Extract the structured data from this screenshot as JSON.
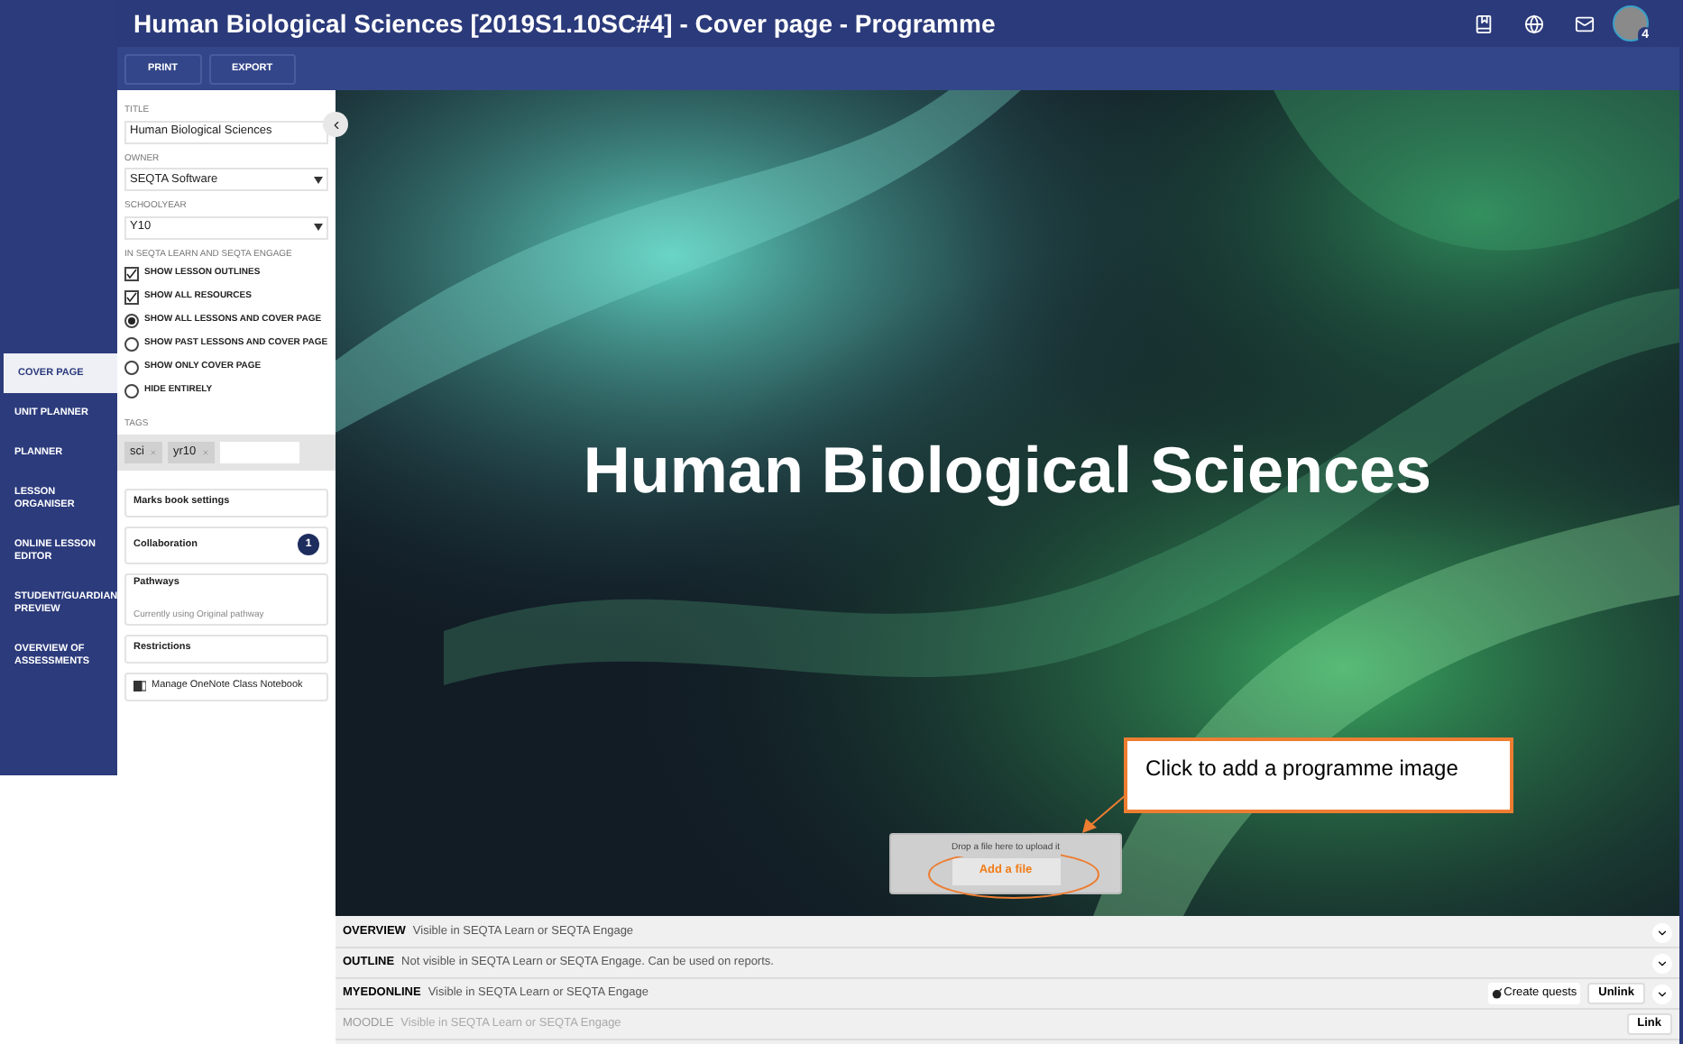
{
  "header": {
    "title": "Human Biological Sciences [2019S1.10SC#4] - Cover page - Programme",
    "notification_count": "4"
  },
  "toolbar": [
    "PRINT",
    "EXPORT"
  ],
  "nav": [
    {
      "label": "COVER PAGE",
      "selected": true
    },
    {
      "label": "UNIT PLANNER",
      "selected": false
    },
    {
      "label": "PLANNER",
      "selected": false
    },
    {
      "label": "LESSON ORGANISER",
      "selected": false
    },
    {
      "label": "ONLINE LESSON EDITOR",
      "selected": false
    },
    {
      "label": "STUDENT/GUARDIAN PREVIEW",
      "selected": false
    },
    {
      "label": "OVERVIEW OF ASSESSMENTS",
      "selected": false
    }
  ],
  "form": {
    "title_label": "TITLE",
    "title_value": "Human Biological Sciences",
    "owner_label": "OWNER",
    "owner_value": "SEQTA Software",
    "year_label": "SCHOOLYEAR",
    "year_value": "Y10",
    "visibility_label": "IN SEQTA LEARN AND SEQTA ENGAGE",
    "options": [
      {
        "kind": "checkbox",
        "label": "SHOW LESSON OUTLINES",
        "checked": true
      },
      {
        "kind": "checkbox",
        "label": "SHOW ALL RESOURCES",
        "checked": true
      },
      {
        "kind": "radio",
        "label": "SHOW ALL LESSONS AND COVER PAGE",
        "checked": true
      },
      {
        "kind": "radio",
        "label": "SHOW PAST LESSONS AND COVER PAGE",
        "checked": false
      },
      {
        "kind": "radio",
        "label": "SHOW ONLY COVER PAGE",
        "checked": false
      },
      {
        "kind": "radio",
        "label": "HIDE ENTIRELY",
        "checked": false
      }
    ],
    "tags_label": "TAGS",
    "tags": [
      "sci",
      "yr10"
    ]
  },
  "cards": [
    {
      "title": "Marks book settings"
    },
    {
      "title": "Collaboration",
      "badge": "1"
    },
    {
      "title": "Pathways",
      "subtitle": "Currently using Original pathway"
    },
    {
      "title": "Restrictions"
    },
    {
      "title": "Manage OneNote Class Notebook",
      "kind": "onenote"
    }
  ],
  "cover": {
    "heading": "Human Biological Sciences",
    "drop_hint": "Drop a file here to upload it",
    "upload_button": "Add a file",
    "callout": "Click to add a programme image"
  },
  "sections": [
    {
      "name": "OVERVIEW",
      "description": "Visible in SEQTA Learn or SEQTA Engage",
      "disabled": false,
      "expandable": true
    },
    {
      "name": "OUTLINE",
      "description": "Not visible in SEQTA Learn or SEQTA Engage. Can be used on reports.",
      "disabled": false,
      "expandable": true
    },
    {
      "name": "MYEDONLINE",
      "description": "Visible in SEQTA Learn or SEQTA Engage",
      "disabled": false,
      "expandable": true,
      "actions": [
        {
          "kind": "quests",
          "label": "Create quests"
        },
        {
          "kind": "button",
          "label": "Unlink"
        }
      ]
    },
    {
      "name": "MOODLE",
      "description": "Visible in SEQTA Learn or SEQTA Engage",
      "disabled": true,
      "expandable": false,
      "actions": [
        {
          "kind": "button",
          "label": "Link"
        }
      ]
    }
  ]
}
